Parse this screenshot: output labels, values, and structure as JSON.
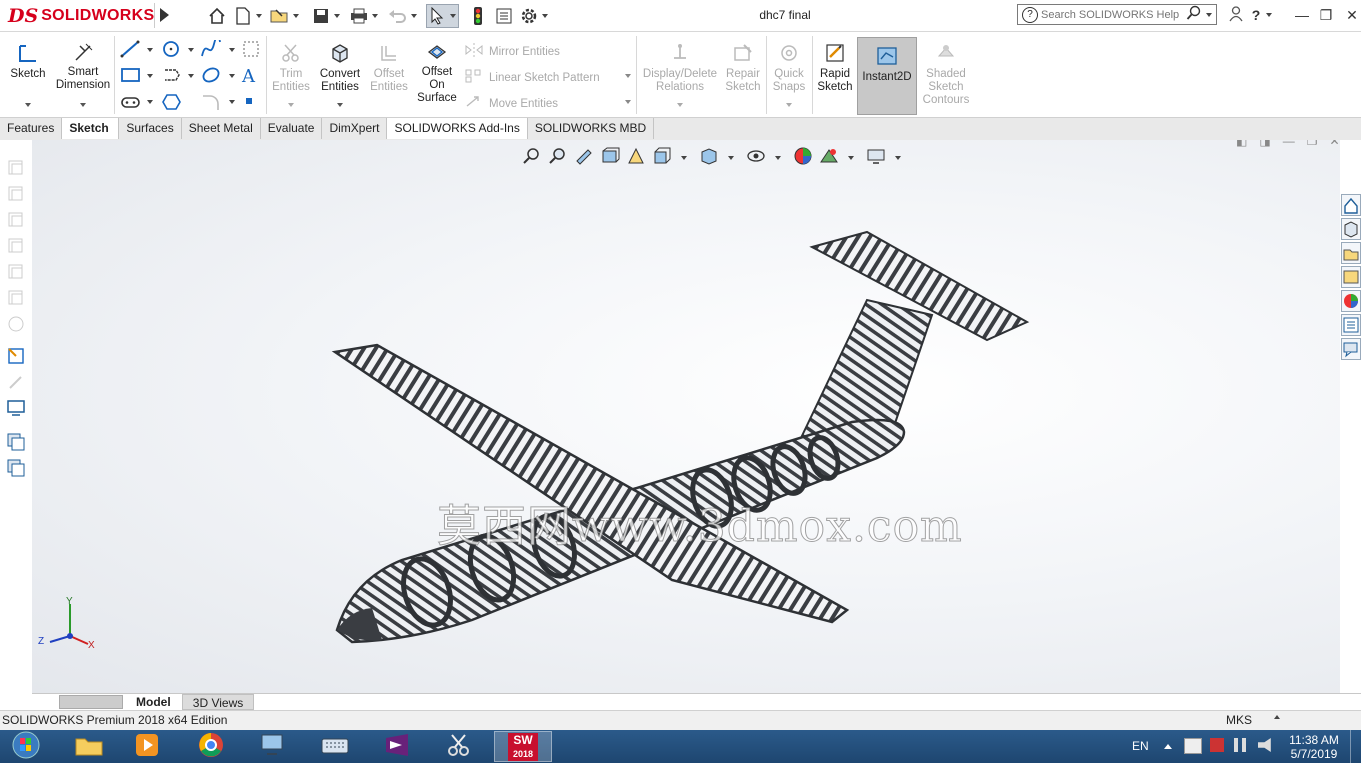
{
  "app": {
    "logo_ds": "DS",
    "logo_text": "SOLIDWORKS",
    "doc_title": "dhc7 final",
    "search_placeholder": "Search SOLIDWORKS Help"
  },
  "toolbar": {
    "sketch": "Sketch",
    "smart_dimension_1": "Smart",
    "smart_dimension_2": "Dimension",
    "trim_1": "Trim",
    "trim_2": "Entities",
    "convert_1": "Convert",
    "convert_2": "Entities",
    "offset_1": "Offset",
    "offset_2": "Entities",
    "offset_surface_1": "Offset",
    "offset_surface_2": "On",
    "offset_surface_3": "Surface",
    "mirror": "Mirror Entities",
    "linear_pattern": "Linear Sketch Pattern",
    "move": "Move Entities",
    "display_delete_1": "Display/Delete",
    "display_delete_2": "Relations",
    "repair_1": "Repair",
    "repair_2": "Sketch",
    "quick_snaps_1": "Quick",
    "quick_snaps_2": "Snaps",
    "rapid_1": "Rapid",
    "rapid_2": "Sketch",
    "instant2d": "Instant2D",
    "shaded_1": "Shaded",
    "shaded_2": "Sketch",
    "shaded_3": "Contours"
  },
  "tabs": [
    "Features",
    "Sketch",
    "Surfaces",
    "Sheet Metal",
    "Evaluate",
    "DimXpert",
    "SOLIDWORKS Add-Ins",
    "SOLIDWORKS MBD"
  ],
  "active_tab": "Sketch",
  "watermark": "莫西网www.3dmox.com",
  "triad": {
    "x": "X",
    "y": "Y",
    "z": "Z"
  },
  "bottom_tabs": {
    "model": "Model",
    "views3d": "3D Views"
  },
  "status": {
    "edition": "SOLIDWORKS Premium 2018 x64 Edition",
    "units": "MKS"
  },
  "taskbar": {
    "lang": "EN",
    "time": "11:38 AM",
    "date": "5/7/2019",
    "sw_year": "2018",
    "sw_label": "SW"
  },
  "colors": {
    "brand": "#d6001c",
    "taskbar": "#1e4670",
    "model": "#3a3d42"
  }
}
